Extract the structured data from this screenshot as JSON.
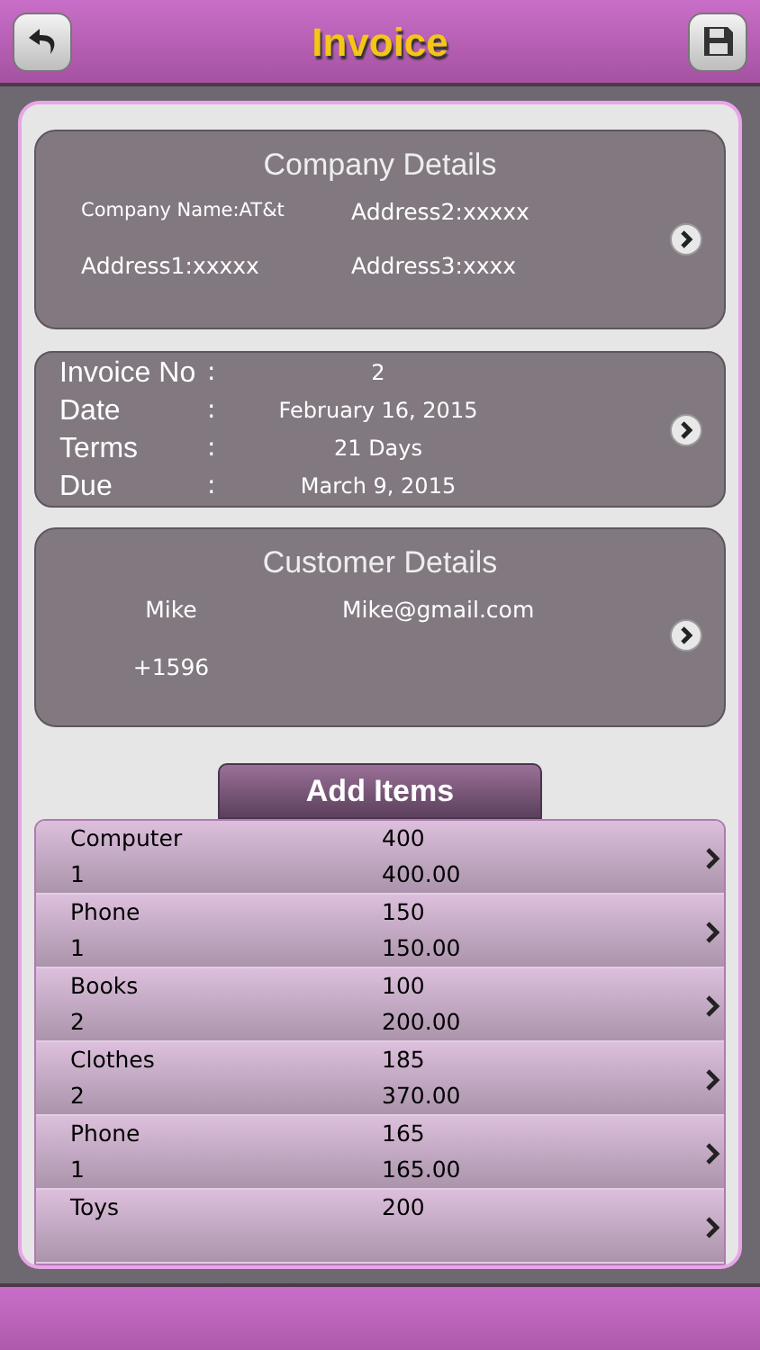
{
  "header": {
    "title": "Invoice"
  },
  "company": {
    "title": "Company Details",
    "fields": [
      "Company Name:AT&t",
      "Address2:xxxxx",
      "Address1:xxxxx",
      "Address3:xxxx"
    ]
  },
  "invoice": {
    "rows": [
      {
        "label": "Invoice No",
        "sep": ":",
        "value": "2"
      },
      {
        "label": "Date",
        "sep": ":",
        "value": "February 16, 2015"
      },
      {
        "label": "Terms",
        "sep": ":",
        "value": "21 Days"
      },
      {
        "label": "Due",
        "sep": ":",
        "value": "March 9, 2015"
      }
    ]
  },
  "customer": {
    "title": "Customer Details",
    "name": "Mike",
    "email": "Mike@gmail.com",
    "phone": "+1596"
  },
  "add_button": "Add Items",
  "items": [
    {
      "name": "Computer",
      "price": "400",
      "qty": "1",
      "total": "400.00"
    },
    {
      "name": "Phone",
      "price": "150",
      "qty": "1",
      "total": "150.00"
    },
    {
      "name": "Books",
      "price": "100",
      "qty": "2",
      "total": "200.00"
    },
    {
      "name": "Clothes",
      "price": "185",
      "qty": "2",
      "total": "370.00"
    },
    {
      "name": "Phone",
      "price": "165",
      "qty": "1",
      "total": "165.00"
    },
    {
      "name": "Toys",
      "price": "200"
    }
  ]
}
